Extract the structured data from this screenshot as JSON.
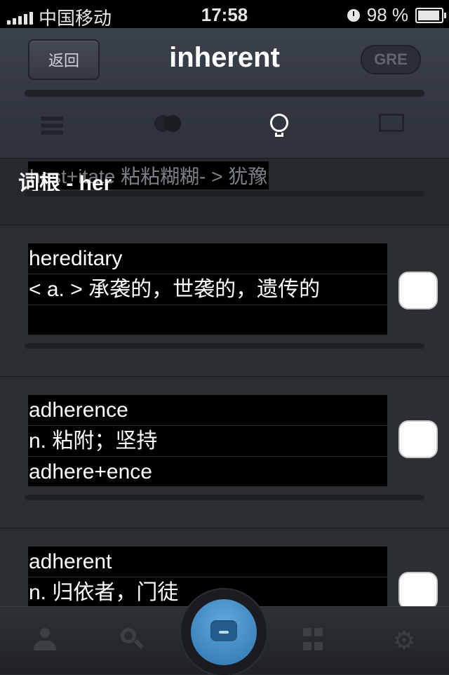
{
  "status_bar": {
    "carrier": "中国移动",
    "time": "17:58",
    "battery": "98 %"
  },
  "header": {
    "back_label": "返回",
    "title": "inherent",
    "badge": "GRE"
  },
  "nav_icons": [
    "list-icon",
    "circles-icon",
    "lightbulb-icon",
    "chart-icon"
  ],
  "content": {
    "prev_line": "hest+itate 粘粘糊糊- > 犹豫",
    "section_title": "词根 - her",
    "words": [
      {
        "word": "hereditary",
        "meaning": "< a. > 承袭的，世袭的，遗传的",
        "root": ""
      },
      {
        "word": "adherence",
        "meaning": "n.  粘附；坚持",
        "root": "adhere+ence"
      },
      {
        "word": "adherent",
        "meaning": "n.  归依者，门徒",
        "root": ""
      }
    ]
  },
  "tab_bar": [
    "user-icon",
    "search-icon",
    "keyboard-icon",
    "grid-icon",
    "gear-icon"
  ]
}
